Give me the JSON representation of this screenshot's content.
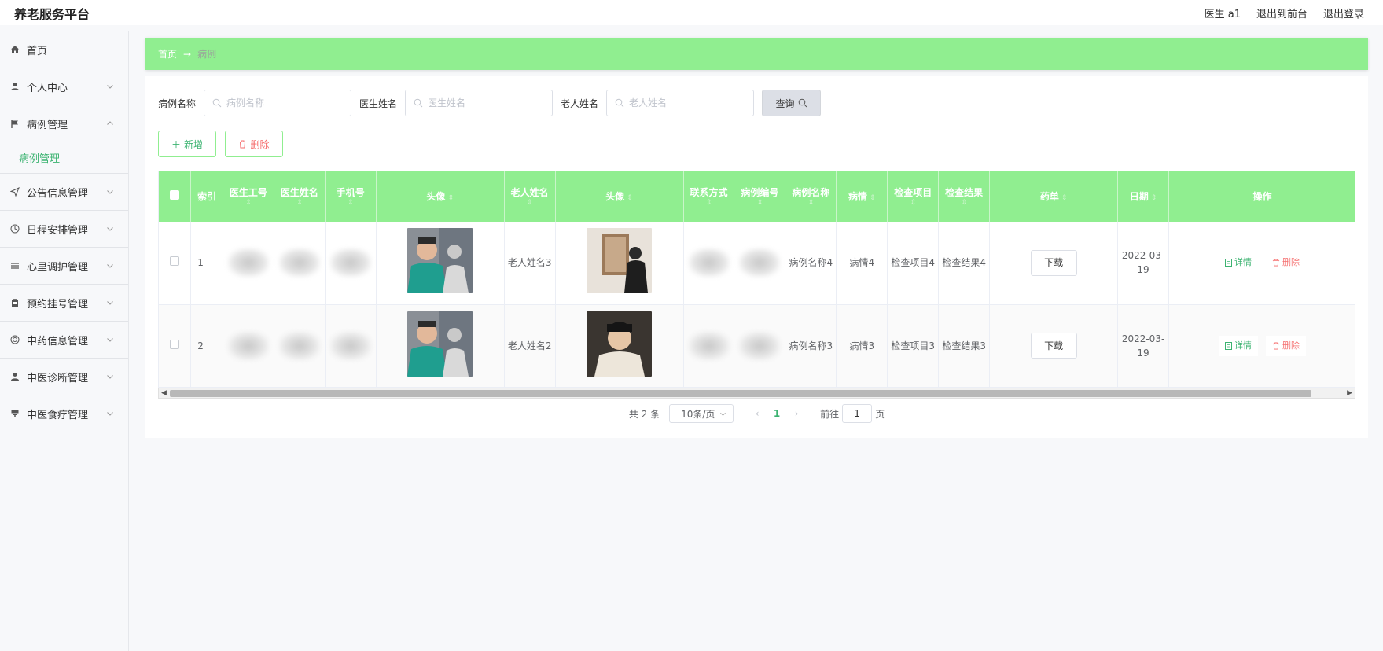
{
  "app": {
    "title": "养老服务平台"
  },
  "topnav": {
    "user": "医生 a1",
    "to_front": "退出到前台",
    "logout": "退出登录"
  },
  "sidebar": {
    "items": [
      {
        "label": "首页",
        "icon": "home-icon"
      },
      {
        "label": "个人中心",
        "icon": "user-icon"
      },
      {
        "label": "病例管理",
        "icon": "flag-icon",
        "expanded": true,
        "sub": "病例管理"
      },
      {
        "label": "公告信息管理",
        "icon": "send-icon"
      },
      {
        "label": "日程安排管理",
        "icon": "clock-icon"
      },
      {
        "label": "心里调护管理",
        "icon": "list-icon"
      },
      {
        "label": "预约挂号管理",
        "icon": "clipboard-icon"
      },
      {
        "label": "中药信息管理",
        "icon": "circle-icon"
      },
      {
        "label": "中医诊断管理",
        "icon": "user-icon"
      },
      {
        "label": "中医食疗管理",
        "icon": "bowl-icon"
      }
    ]
  },
  "breadcrumb": {
    "home": "首页",
    "sep": "→",
    "current": "病例"
  },
  "search": {
    "case_label": "病例名称",
    "case_placeholder": "病例名称",
    "doctor_label": "医生姓名",
    "doctor_placeholder": "医生姓名",
    "elder_label": "老人姓名",
    "elder_placeholder": "老人姓名",
    "query_label": "查询"
  },
  "actions": {
    "add_label": "新增",
    "delete_label": "删除"
  },
  "table": {
    "columns": [
      "索引",
      "医生工号",
      "医生姓名",
      "手机号",
      "头像",
      "老人姓名",
      "头像",
      "联系方式",
      "病例编号",
      "病例名称",
      "病情",
      "检查项目",
      "检查结果",
      "药单",
      "日期",
      "操作"
    ],
    "rows": [
      {
        "index": "1",
        "elder_name": "老人姓名3",
        "case_name": "病例名称4",
        "condition": "病情4",
        "check_item": "检查项目4",
        "check_result": "检查结果4",
        "date": "2022-03-19"
      },
      {
        "index": "2",
        "elder_name": "老人姓名2",
        "case_name": "病例名称3",
        "condition": "病情3",
        "check_item": "检查项目3",
        "check_result": "检查结果3",
        "date": "2022-03-19"
      }
    ],
    "download_label": "下载",
    "detail_label": "详情",
    "row_delete_label": "删除"
  },
  "pagination": {
    "total": "共 2 条",
    "page_size": "10条/页",
    "current": "1",
    "goto_prefix": "前往",
    "goto_value": "1",
    "goto_suffix": "页"
  },
  "colors": {
    "accent": "#90ee90",
    "active_text": "#3cb371",
    "danger": "#f56c6c"
  }
}
